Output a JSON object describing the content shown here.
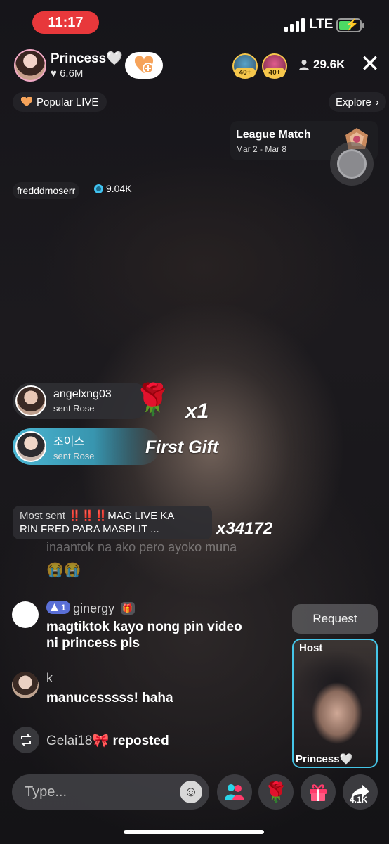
{
  "status_bar": {
    "time": "11:17",
    "network": "LTE"
  },
  "host": {
    "name": "Princess🤍",
    "likes": "6.6M"
  },
  "top_viewers": [
    {
      "badge": "40+"
    },
    {
      "badge": "40+"
    }
  ],
  "viewer_count": "29.6K",
  "popular": {
    "label": "Popular LIVE"
  },
  "explore": {
    "label": "Explore"
  },
  "league": {
    "title": "League Match",
    "dates": "Mar 2 - Mar 8"
  },
  "top_gifter": {
    "name": "fredddmoserr",
    "coins": "9.04K"
  },
  "gifts": [
    {
      "user": "angelxng03",
      "action": "sent Rose",
      "label": "x1"
    },
    {
      "user": "조이스",
      "action": "sent Rose",
      "label": "First Gift"
    }
  ],
  "most_sent": {
    "lead": "Most sent",
    "line1": "‼️‼️‼️MAG LIVE KA",
    "line2": "RIN FRED PARA MASPLIT ...",
    "count": "x34172"
  },
  "faded_comment": {
    "text": "inaantok na ako pero ayoko muna",
    "emoji": "😭😭"
  },
  "comments": [
    {
      "badge_level": "1",
      "user": "ginergy",
      "text": "magtiktok kayo nong pin video ni princess pls"
    },
    {
      "user": "k",
      "text": "manucesssss! haha"
    }
  ],
  "repost": {
    "user": "Gelai18🎀",
    "action": "reposted"
  },
  "request": {
    "label": "Request"
  },
  "host_card": {
    "label": "Host",
    "name": "Princess🤍"
  },
  "input": {
    "placeholder": "Type..."
  },
  "share": {
    "count": "4.1K"
  },
  "colors": {
    "accent_teal": "#45c6e8",
    "live_red": "#e8383b",
    "gift_pink": "#ff3b6b"
  }
}
